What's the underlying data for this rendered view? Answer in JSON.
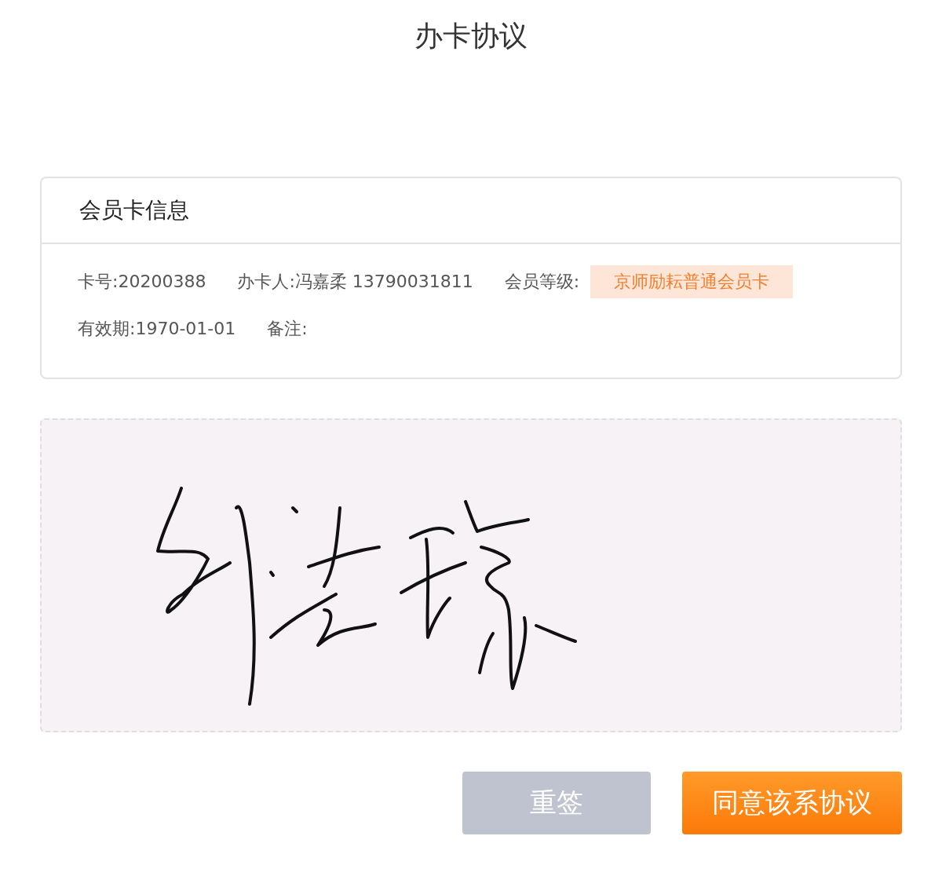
{
  "title": "办卡协议",
  "card": {
    "title": "会员卡信息",
    "rows": [
      [
        {
          "kind": "text",
          "text": "卡号:20200388"
        },
        {
          "kind": "text",
          "text": "办卡人:冯嘉柔 13790031811"
        },
        {
          "kind": "text",
          "text": "会员等级:"
        },
        {
          "kind": "tag",
          "text": "京师励耘普通会员卡"
        }
      ],
      [
        {
          "kind": "text",
          "text": "有效期:1970-01-01"
        },
        {
          "kind": "text",
          "text": "备注:"
        }
      ]
    ]
  },
  "buttons": [
    {
      "label": "重签",
      "kind": "secondary"
    },
    {
      "label": "同意该系协议",
      "kind": "primary"
    }
  ]
}
